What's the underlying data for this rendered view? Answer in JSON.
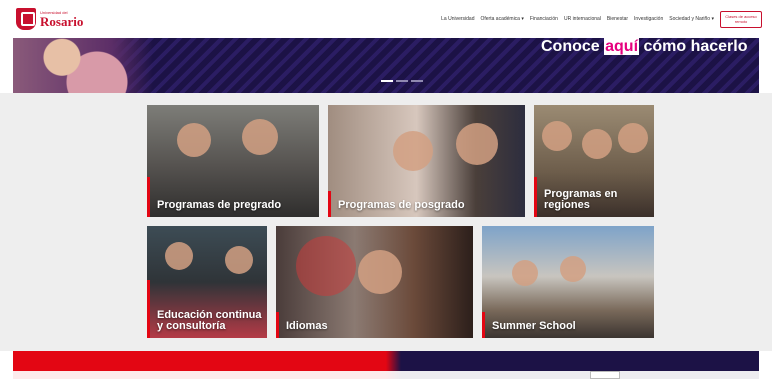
{
  "header": {
    "logo_small": "Universidad del",
    "logo_big": "Rosario",
    "nav": [
      "La Universidad",
      "Oferta académica ▾",
      "Financiación",
      "UR internacional",
      "Bienestar",
      "Investigación",
      "Sociedad y Nariño ▾"
    ],
    "access_button": "Clases de acceso remoto"
  },
  "hero": {
    "text_before": "Conoce ",
    "text_highlight": "aquí",
    "text_after": " cómo hacerlo",
    "dots": 3,
    "active_dot": 0
  },
  "programs": [
    {
      "label": "Programas de pregrado"
    },
    {
      "label": "Programas de posgrado"
    },
    {
      "label": "Programas en regiones"
    },
    {
      "label": "Educación continua y consultoría"
    },
    {
      "label": "Idiomas"
    },
    {
      "label": "Summer School"
    }
  ],
  "colors": {
    "brand_red": "#c8102e",
    "accent_red": "#e30613",
    "navy": "#1c1246",
    "highlight_pink": "#e6007e"
  }
}
